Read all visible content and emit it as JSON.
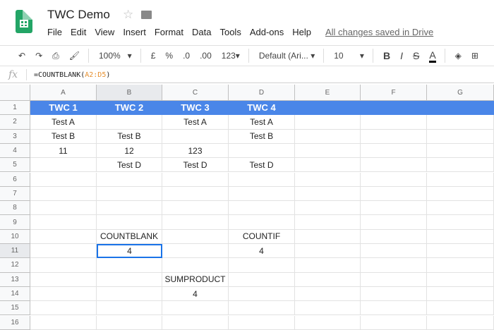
{
  "title": "TWC Demo",
  "menu": [
    "File",
    "Edit",
    "View",
    "Insert",
    "Format",
    "Data",
    "Tools",
    "Add-ons",
    "Help"
  ],
  "saved": "All changes saved in Drive",
  "toolbar": {
    "zoom": "100%",
    "currency": "£",
    "percent": "%",
    "dec_less": ".0",
    "dec_more": ".00",
    "format": "123",
    "font": "Default (Ari...",
    "size": "10",
    "bold": "B",
    "italic": "I",
    "strike": "S",
    "color": "A"
  },
  "formula": {
    "fx": "fx",
    "prefix": "=COUNTBLANK(",
    "ref": "A2:D5",
    "suffix": ")"
  },
  "columns": [
    "A",
    "B",
    "C",
    "D",
    "E",
    "F",
    "G"
  ],
  "rows": [
    "1",
    "2",
    "3",
    "4",
    "5",
    "6",
    "7",
    "8",
    "9",
    "10",
    "11",
    "12",
    "13",
    "14",
    "15",
    "16"
  ],
  "cells": {
    "A1": "TWC 1",
    "B1": "TWC 2",
    "C1": "TWC 3",
    "D1": "TWC 4",
    "A2": "Test A",
    "C2": "Test A",
    "D2": "Test A",
    "A3": "Test B",
    "B3": "Test B",
    "D3": "Test B",
    "A4": "11",
    "B4": "12",
    "C4": "123",
    "B5": "Test D",
    "C5": "Test D",
    "D5": "Test D",
    "B10": "COUNTBLANK",
    "D10": "COUNTIF",
    "B11": "4",
    "D11": "4",
    "C13": "SUMPRODUCT",
    "C14": "4"
  },
  "selected": "B11",
  "header_color": "#4a86e8"
}
